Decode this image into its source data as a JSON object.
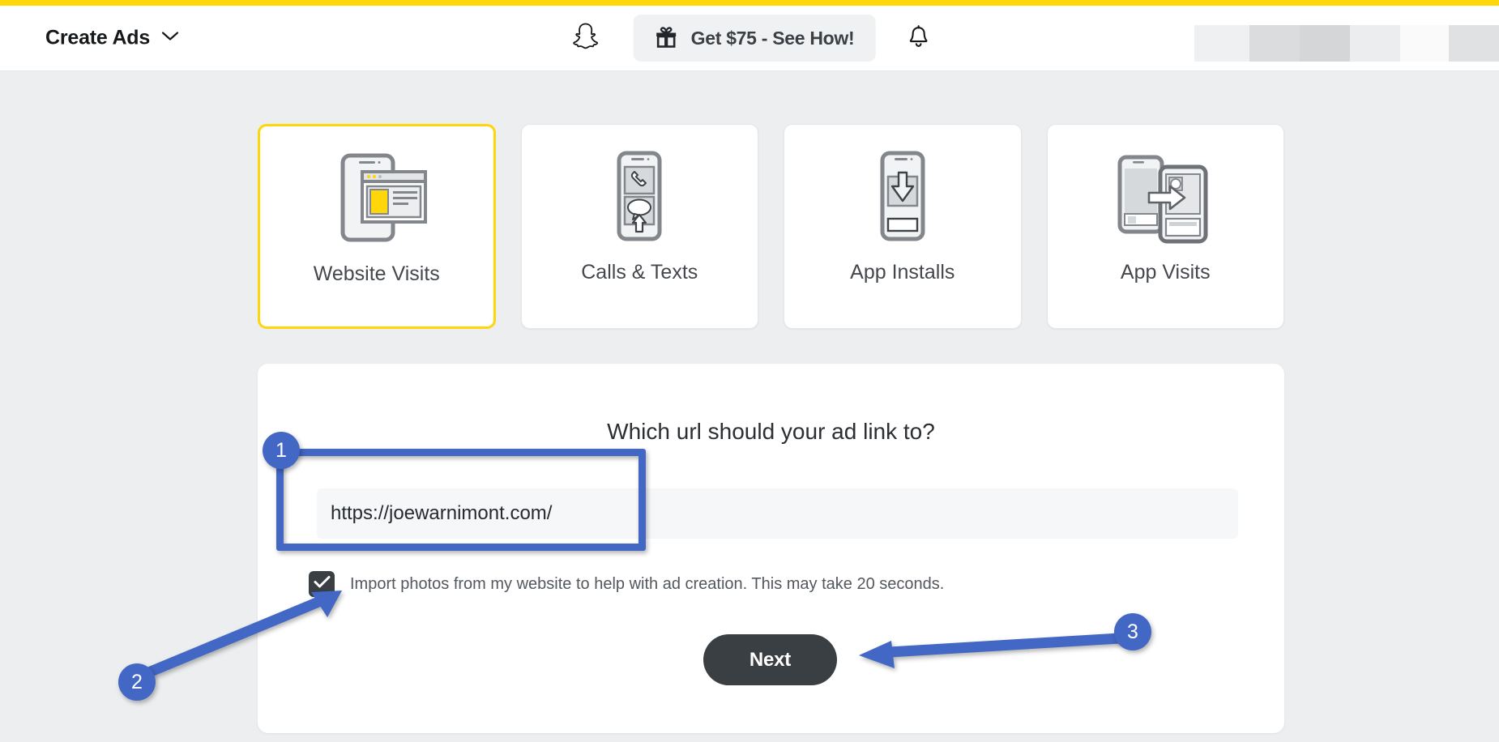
{
  "header": {
    "brand_title": "Create Ads",
    "chevron_icon": "chevron-down-icon",
    "snapchat_logo_icon": "snapchat-ghost-icon",
    "promo": {
      "gift_icon": "gift-icon",
      "label": "Get $75 - See How!"
    },
    "notifications_icon": "bell-icon",
    "accent_color": "#ffd60a"
  },
  "objectives": {
    "cards": [
      {
        "label": "Website Visits",
        "icon": "website-visits-icon",
        "selected": true
      },
      {
        "label": "Calls & Texts",
        "icon": "calls-texts-icon",
        "selected": false
      },
      {
        "label": "App Installs",
        "icon": "app-installs-icon",
        "selected": false
      },
      {
        "label": "App Visits",
        "icon": "app-visits-icon",
        "selected": false
      }
    ]
  },
  "form": {
    "heading": "Which url should your ad link to?",
    "url_input": {
      "value": "https://joewarnimont.com/",
      "placeholder": "https://joewarnimont.com/"
    },
    "import_checkbox": {
      "label": "Import photos from my website to help with ad creation. This may take 20 seconds.",
      "checked": true,
      "check_icon": "check-icon"
    },
    "next_button": "Next"
  },
  "annotations": {
    "color": "#4267c4",
    "markers": [
      {
        "number": "1",
        "target": "url-input"
      },
      {
        "number": "2",
        "target": "import-checkbox"
      },
      {
        "number": "3",
        "target": "next-button"
      }
    ]
  }
}
